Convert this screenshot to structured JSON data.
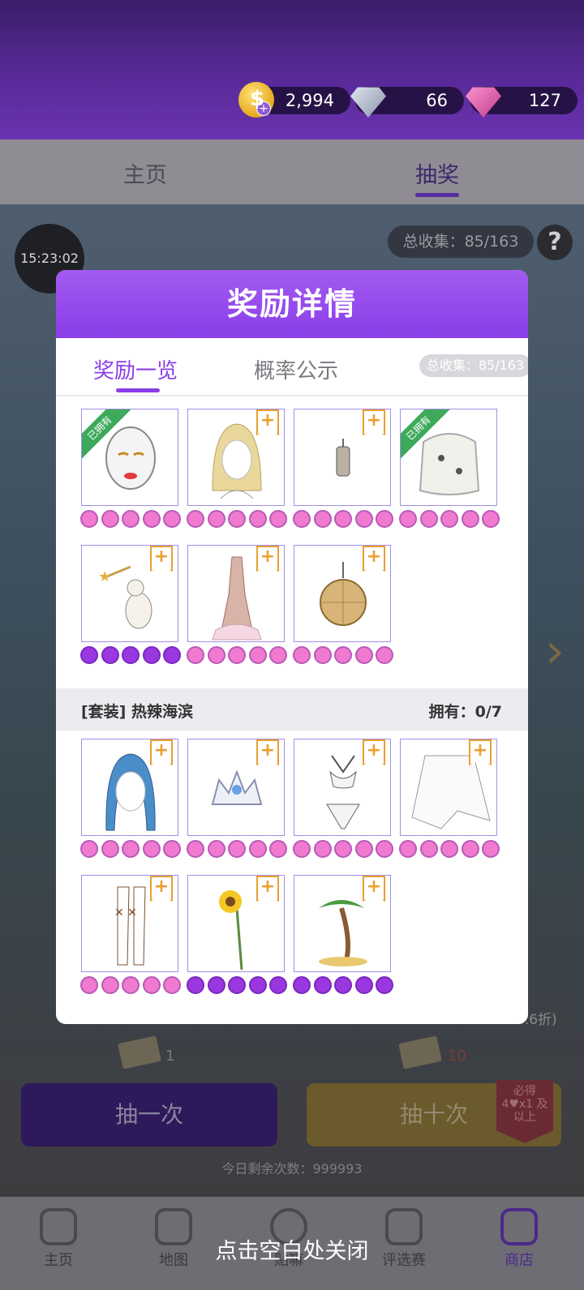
{
  "currency": {
    "coins": "2,994",
    "diamonds": "66",
    "gems": "127"
  },
  "nav_tabs": {
    "home": "主页",
    "lottery": "抽奖"
  },
  "scene": {
    "timer": "15:23:02",
    "total_collect": "总收集：85/163",
    "help": "?",
    "discount": "6.6折)",
    "ticket_count_1": "1",
    "ticket_count_10": "10",
    "draw_one": "抽一次",
    "draw_ten": "抽十次",
    "guarantee": "必得 4♥x1 及以上",
    "remaining": "今日剩余次数：999993"
  },
  "modal": {
    "title": "奖励详情",
    "tab_rewards": "奖励一览",
    "tab_probability": "概率公示",
    "collect_pill": "总收集：85/163",
    "owned_label": "已拥有",
    "set_name": "[套装] 热辣海滨",
    "set_owned": "拥有：0/7",
    "rewards": [
      {
        "name": "makeup-face",
        "owned": true,
        "hearts": "pink"
      },
      {
        "name": "blonde-hair",
        "owned": false,
        "hearts": "pink"
      },
      {
        "name": "earring",
        "owned": false,
        "hearts": "pink"
      },
      {
        "name": "fur-coat",
        "owned": true,
        "hearts": "pink"
      },
      {
        "name": "cat-wand",
        "owned": false,
        "hearts": "purple"
      },
      {
        "name": "gown",
        "owned": false,
        "hearts": "pink"
      },
      {
        "name": "disco-ball",
        "owned": false,
        "hearts": "pink"
      }
    ],
    "set_items": [
      {
        "name": "blue-hair",
        "hearts": "pink"
      },
      {
        "name": "tiara",
        "hearts": "pink"
      },
      {
        "name": "swimsuit",
        "hearts": "pink"
      },
      {
        "name": "lace-shawl",
        "hearts": "pink"
      },
      {
        "name": "butterfly-boots",
        "hearts": "pink"
      },
      {
        "name": "sunflower",
        "hearts": "purple"
      },
      {
        "name": "palm-tree",
        "hearts": "purple"
      }
    ]
  },
  "bottom_nav": {
    "home": "主页",
    "map": "地图",
    "stickers": "贴嘛",
    "contest": "评选赛",
    "store": "商店"
  },
  "close_hint": "点击空白处关闭",
  "colors": {
    "accent_purple": "#8a3ee8",
    "heart_pink": "#f07ad0",
    "heart_purple": "#9a38e0",
    "owned_green": "#3caa5a",
    "plus_orange": "#e8a030"
  }
}
